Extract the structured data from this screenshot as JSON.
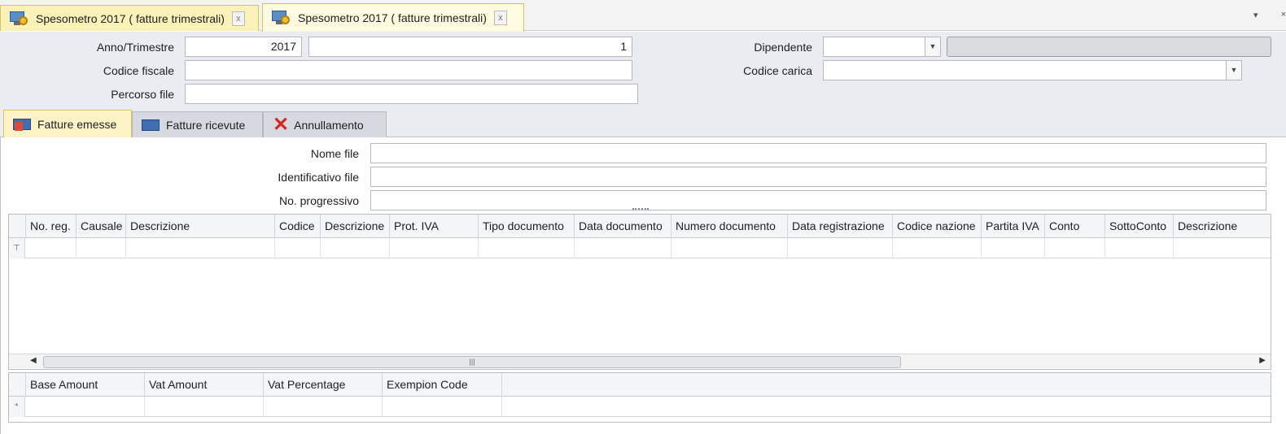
{
  "doc_tabs": [
    {
      "label": "Spesometro 2017 ( fatture trimestrali)",
      "close": "x"
    },
    {
      "label": "Spesometro 2017 ( fatture trimestrali)",
      "close": "x"
    }
  ],
  "window_controls": {
    "menu": "▾",
    "close": "×"
  },
  "form": {
    "anno_label": "Anno/Trimestre",
    "anno_value": "2017",
    "trimestre_value": "1",
    "codice_fiscale_label": "Codice fiscale",
    "codice_fiscale_value": "",
    "percorso_file_label": "Percorso file",
    "percorso_file_value": "",
    "dipendente_label": "Dipendente",
    "dipendente_value": "",
    "codice_carica_label": "Codice carica",
    "codice_carica_value": ""
  },
  "module_tabs": [
    {
      "label": "Fatture emesse",
      "icon": "invoice-out-icon",
      "active": true
    },
    {
      "label": "Fatture ricevute",
      "icon": "invoice-in-icon",
      "active": false
    },
    {
      "label": "Annullamento",
      "icon": "cancel-x-icon",
      "active": false
    }
  ],
  "file_form": {
    "nome_file_label": "Nome file",
    "nome_file_value": "",
    "identificativo_label": "Identificativo file",
    "identificativo_value": "",
    "progressivo_label": "No. progressivo",
    "progressivo_value": ""
  },
  "main_grid": {
    "columns": [
      "No. reg.",
      "Causale",
      "Descrizione",
      "Codice",
      "Descrizione",
      "Prot. IVA",
      "Tipo documento",
      "Data documento",
      "Numero documento",
      "Data registrazione",
      "Codice nazione",
      "Partita IVA",
      "Conto",
      "SottoConto",
      "Descrizione"
    ],
    "filter_glyph": "⊤",
    "scroll_thumb_glyph": "|||"
  },
  "detail_grid": {
    "columns": [
      "Base Amount",
      "Vat Amount",
      "Vat Percentage",
      "Exempion Code"
    ],
    "new_row_glyph": "*"
  },
  "colors": {
    "active_tab_bg": "#fdf3c7",
    "header_bg": "#e9ecf0",
    "cancel_icon": "#d2281e"
  }
}
